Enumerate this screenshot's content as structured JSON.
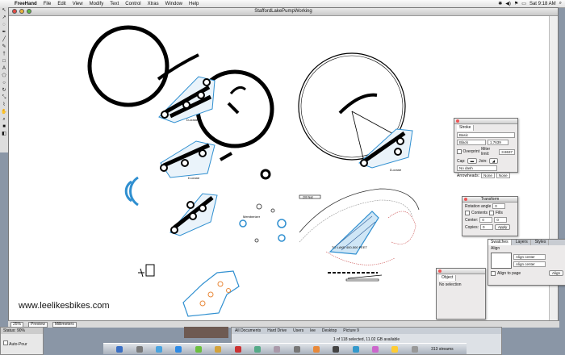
{
  "menubar": {
    "items": [
      "FreeHand",
      "File",
      "Edit",
      "View",
      "Modify",
      "Text",
      "Control",
      "Xtras",
      "Window",
      "Help"
    ],
    "clock": "Sat 9:18 AM"
  },
  "window": {
    "title": "StaffordLakePumpWorking"
  },
  "canvas": {
    "watermark": "www.leelikesbikes.com",
    "labels": {
      "d1": "D-crane",
      "d2": "D-crane",
      "d3": "D-crane",
      "member": "Memberizer",
      "scale": "200 feet",
      "plan": "TO LAKE 400-500 FEET"
    }
  },
  "bottom_bar": {
    "zoom": "25%",
    "view": "Preview",
    "units": "Millimeters"
  },
  "status_panel": {
    "title": "Status: 90%",
    "option": "Auto-Pour"
  },
  "finder": {
    "tabs": [
      "All Documents",
      "Hard Drive",
      "Users",
      "lee",
      "Desktop",
      "Picture 9"
    ],
    "status": "1 of 118 selected, 11.02 GB available"
  },
  "dock": {
    "label": "313 streams"
  },
  "stroke_panel": {
    "tabs": [
      "Stroke"
    ],
    "type": "Basic",
    "color": "Black",
    "width": "1.7639",
    "overprint": "Overprint",
    "miter_label": "Miter limit:",
    "miter": "3.8637",
    "cap_label": "Cap:",
    "join_label": "Join:",
    "dash": "No dash",
    "arrowheads_label": "Arrowheads:",
    "arrow_left": "None",
    "arrow_right": "None"
  },
  "transform_panel": {
    "title": "Transform",
    "rotation_label": "Rotation angle",
    "rotation": "0",
    "contents": "Contents",
    "fills": "Fills",
    "center_label": "Center:",
    "copies_label": "Copies:",
    "x": "0",
    "y": "0",
    "copies": "0",
    "apply": "Apply"
  },
  "align_panel": {
    "tabs": [
      "Swatches",
      "Layers",
      "Styles"
    ],
    "title": "Align",
    "h_align": "Align center",
    "v_align": "Align center",
    "to_page": "Align to page",
    "apply": "Align"
  },
  "object_panel": {
    "title": "Object",
    "content": "No selection"
  },
  "colors": {
    "dock": "#aab2bd",
    "stroke_blue": "#2f8fd0",
    "track_orange": "#e8893a"
  }
}
